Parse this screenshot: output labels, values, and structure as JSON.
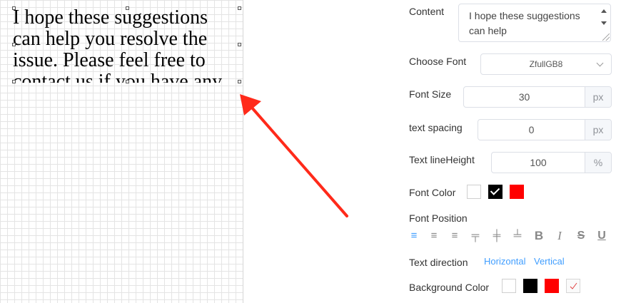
{
  "canvas": {
    "text_lines": [
      "I hope these suggestions",
      "can help you resolve the",
      "issue. Please feel free to",
      "contact us if you have any"
    ]
  },
  "panel": {
    "content": {
      "label": "Content",
      "value": "I hope these suggestions can help"
    },
    "font": {
      "label": "Choose Font",
      "value": "ZfullGB8"
    },
    "font_size": {
      "label": "Font Size",
      "value": "30",
      "unit": "px"
    },
    "text_spacing": {
      "label": "text spacing",
      "value": "0",
      "unit": "px"
    },
    "line_height": {
      "label": "Text lineHeight",
      "value": "100",
      "unit": "%"
    },
    "font_color": {
      "label": "Font Color",
      "swatches": [
        "#ffffff",
        "#000000",
        "#ff0000"
      ],
      "selected": "#000000"
    },
    "font_position": {
      "label": "Font Position",
      "icons": [
        "align-left-icon",
        "align-center-icon",
        "align-right-icon",
        "align-top-icon",
        "align-middle-icon",
        "align-bottom-icon",
        "bold-icon",
        "italic-icon",
        "strikethrough-icon",
        "underline-icon"
      ],
      "glyphs": [
        "≡",
        "≡",
        "≡",
        "╤",
        "╪",
        "╧",
        "B",
        "I",
        "S",
        "U"
      ],
      "active": "align-left-icon"
    },
    "text_direction": {
      "label": "Text direction",
      "options": [
        "Horizontal",
        "Vertical"
      ]
    },
    "background_color": {
      "label": "Background Color",
      "swatches": [
        "#ffffff",
        "#000000",
        "#ff0000",
        "transparent"
      ]
    }
  },
  "colors": {
    "accent": "#409eff",
    "arrow": "#ff2a1a"
  }
}
